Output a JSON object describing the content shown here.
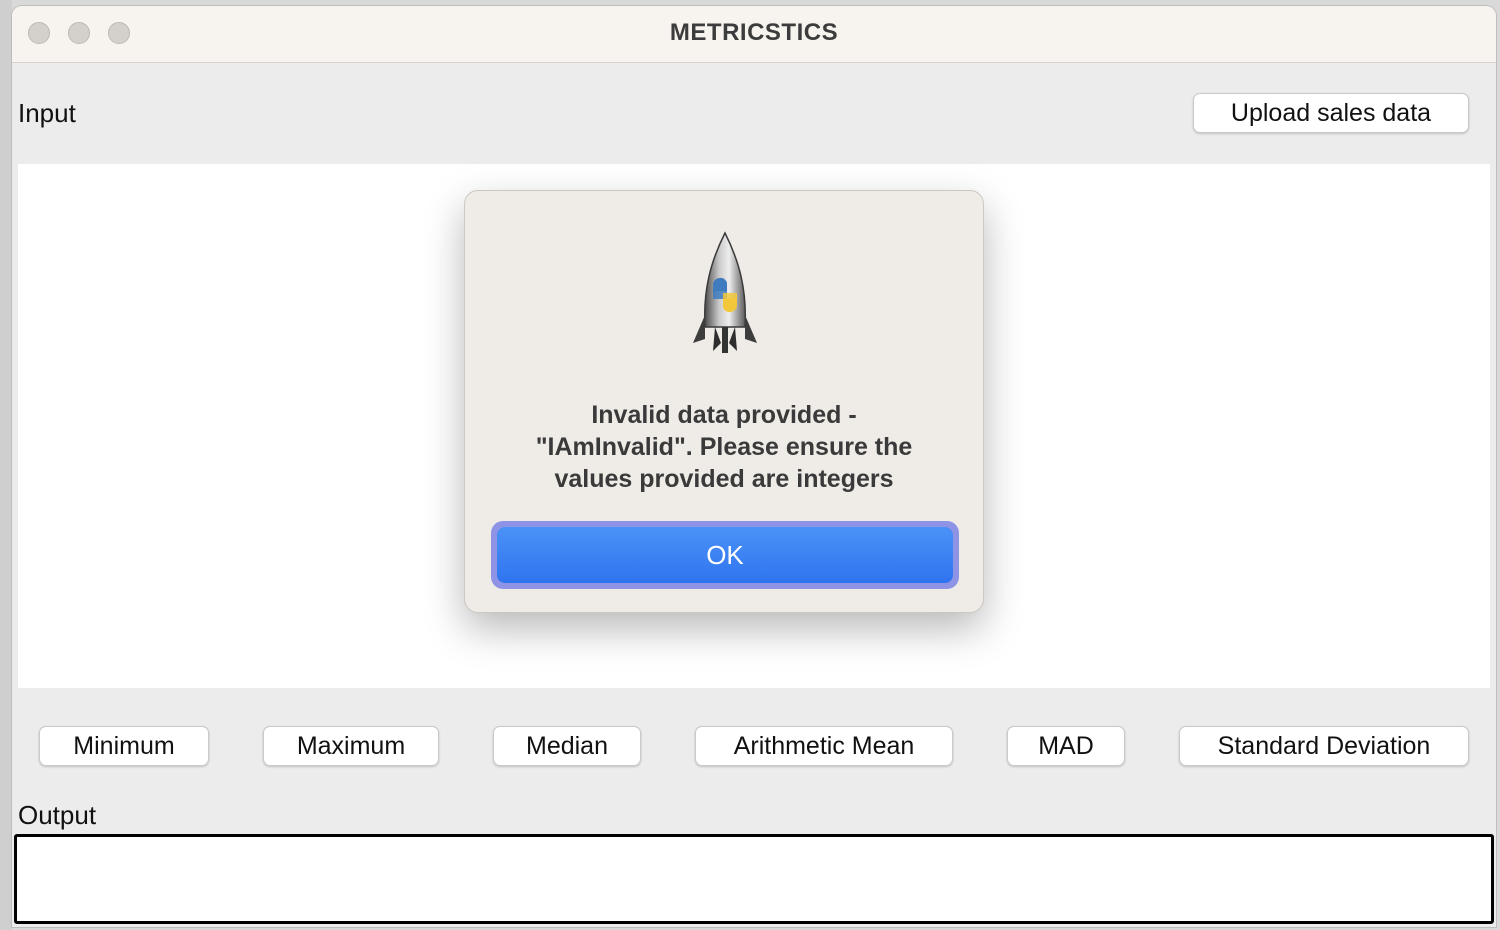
{
  "window": {
    "title": "METRICSTICS"
  },
  "input": {
    "label": "Input",
    "upload_button": "Upload sales data"
  },
  "metrics": {
    "buttons": [
      "Minimum",
      "Maximum",
      "Median",
      "Arithmetic Mean",
      "MAD",
      "Standard Deviation"
    ]
  },
  "output": {
    "label": "Output"
  },
  "dialog": {
    "icon": "python-launcher-rocket-icon",
    "message_lines": [
      "Invalid data provided -",
      "\"IAmInvalid\". Please ensure the",
      "values provided are integers"
    ],
    "ok_label": "OK"
  },
  "colors": {
    "window_bg": "#ececec",
    "titlebar_bg": "#f7f3ee",
    "dialog_bg": "#efebe7",
    "ok_button": "#3b82f6",
    "focus_ring": "#8f93e6"
  }
}
